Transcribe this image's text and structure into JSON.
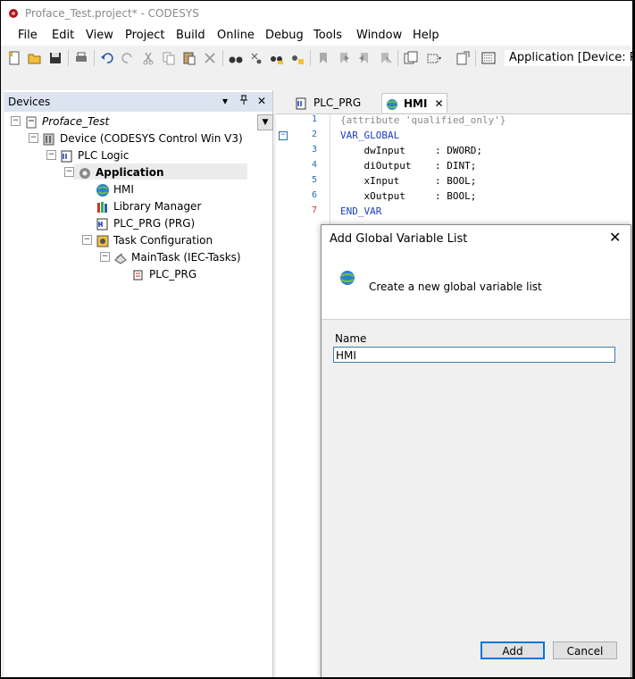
{
  "window": {
    "title": "Proface_Test.project* - CODESYS"
  },
  "menu": [
    "File",
    "Edit",
    "View",
    "Project",
    "Build",
    "Online",
    "Debug",
    "Tools",
    "Window",
    "Help"
  ],
  "toolbar": {
    "active_app": "Application [Device: PLC"
  },
  "devices_panel": {
    "title": "Devices",
    "pin_label": "\u0004",
    "close_label": "✕",
    "menu_label": "▾",
    "tree": {
      "root": "Proface_Test",
      "device": "Device (CODESYS Control Win V3)",
      "plc_logic": "PLC Logic",
      "application": "Application",
      "hmi": "HMI",
      "library_manager": "Library Manager",
      "plc_prg": "PLC_PRG (PRG)",
      "task_config": "Task Configuration",
      "main_task": "MainTask (IEC-Tasks)",
      "main_task_prg": "PLC_PRG"
    }
  },
  "editor": {
    "tabs": [
      {
        "label": "PLC_PRG"
      },
      {
        "label": "HMI",
        "close": "✕"
      }
    ],
    "code_lines": [
      {
        "num": "1",
        "text": "{attribute 'qualified_only'}"
      },
      {
        "num": "2",
        "text": "VAR_GLOBAL"
      },
      {
        "num": "3",
        "text": "    dwInput     : DWORD;"
      },
      {
        "num": "4",
        "text": "    diOutput    : DINT;"
      },
      {
        "num": "5",
        "text": "    xInput      : BOOL;"
      },
      {
        "num": "6",
        "text": "    xOutput     : BOOL;"
      },
      {
        "num": "7",
        "text": "END_VAR"
      }
    ]
  },
  "dialog": {
    "title": "Add Global Variable List",
    "close": "✕",
    "description": "Create a new global variable list",
    "name_label": "Name",
    "name_value": "HMI",
    "add_button": "Add",
    "cancel_button": "Cancel"
  },
  "colors": {
    "keyword": "#1a3fbf",
    "comment": "#8a8a8a",
    "line_numbers": "#2a6cb0",
    "panel_header": "#dbe4f0"
  }
}
